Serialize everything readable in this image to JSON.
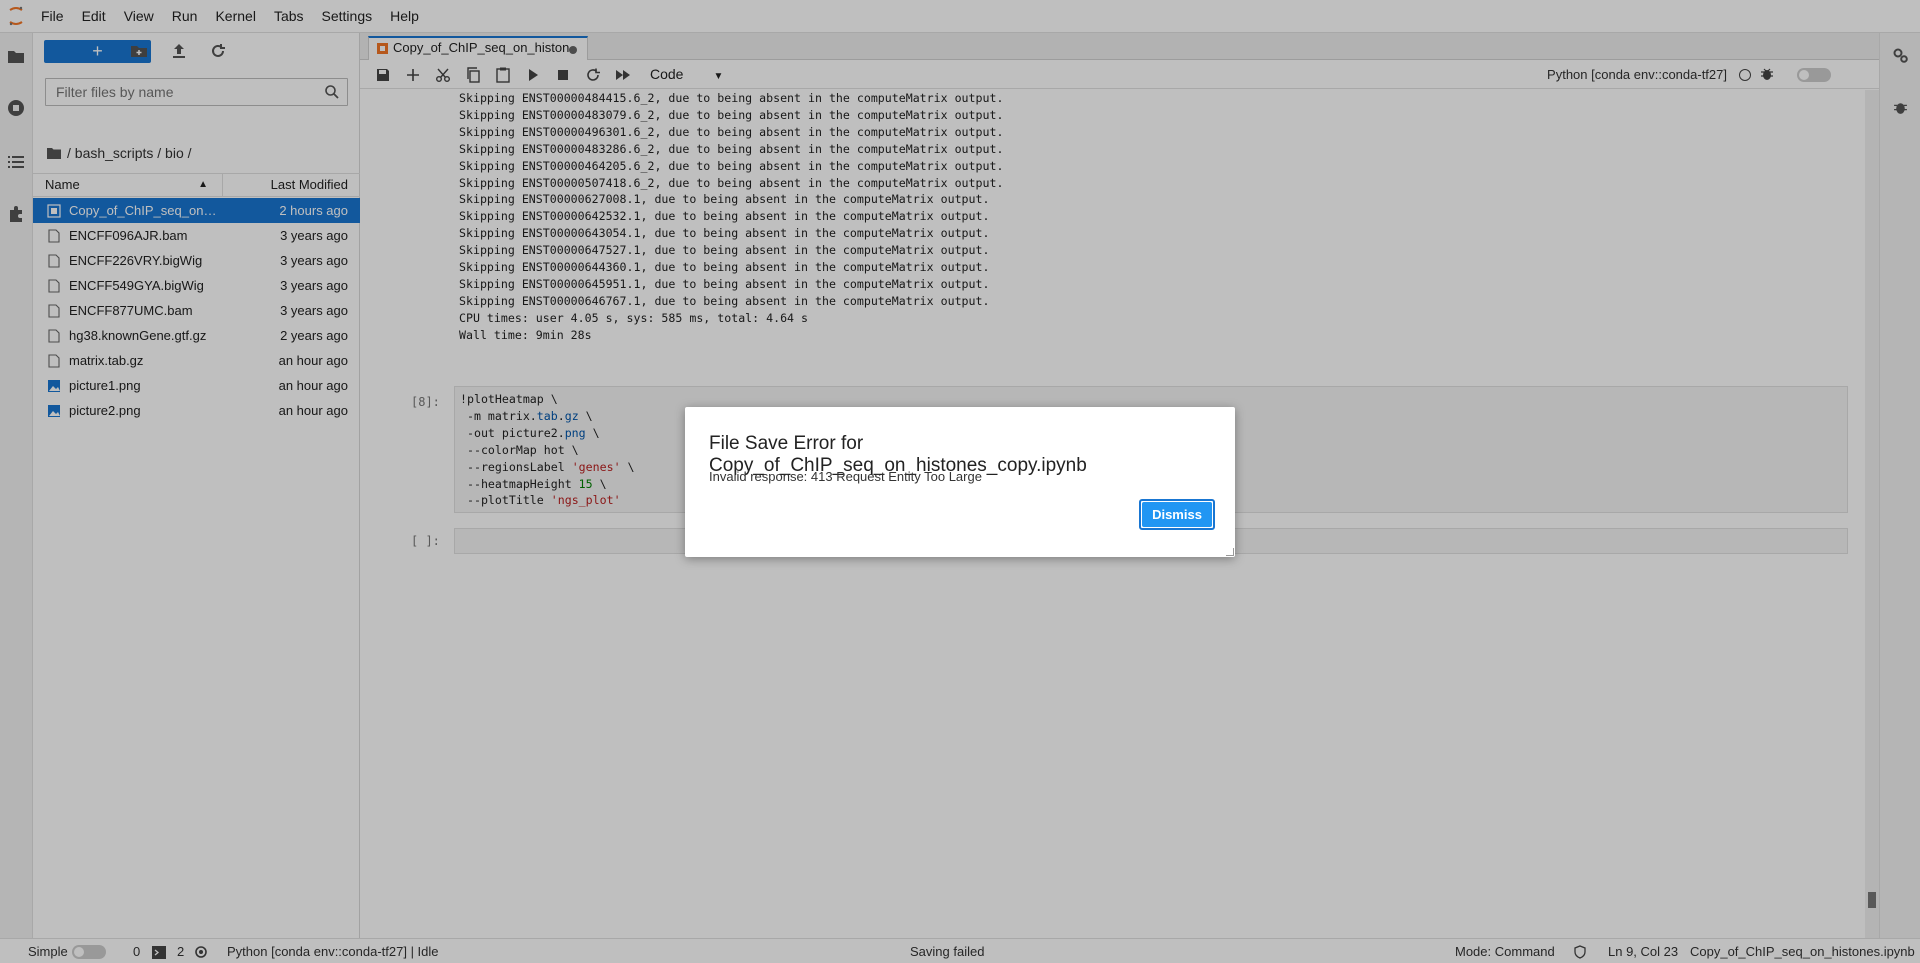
{
  "menubar": {
    "items": [
      "File",
      "Edit",
      "View",
      "Run",
      "Kernel",
      "Tabs",
      "Settings",
      "Help"
    ]
  },
  "filebrowser": {
    "new_label": "+",
    "filter_placeholder": "Filter files by name",
    "breadcrumb": "/ bash_scripts / bio /",
    "col_name": "Name",
    "col_modified": "Last Modified",
    "files": [
      {
        "name": "Copy_of_ChIP_seq_on_hi...",
        "modified": "2 hours ago",
        "icon": "notebook-icon",
        "selected": true
      },
      {
        "name": "ENCFF096AJR.bam",
        "modified": "3 years ago",
        "icon": "file-icon"
      },
      {
        "name": "ENCFF226VRY.bigWig",
        "modified": "3 years ago",
        "icon": "file-icon"
      },
      {
        "name": "ENCFF549GYA.bigWig",
        "modified": "3 years ago",
        "icon": "file-icon"
      },
      {
        "name": "ENCFF877UMC.bam",
        "modified": "3 years ago",
        "icon": "file-icon"
      },
      {
        "name": "hg38.knownGene.gtf.gz",
        "modified": "2 years ago",
        "icon": "file-icon"
      },
      {
        "name": "matrix.tab.gz",
        "modified": "an hour ago",
        "icon": "file-icon"
      },
      {
        "name": "picture1.png",
        "modified": "an hour ago",
        "icon": "image-icon"
      },
      {
        "name": "picture2.png",
        "modified": "an hour ago",
        "icon": "image-icon"
      }
    ]
  },
  "tab": {
    "title": "Copy_of_ChIP_seq_on_histon"
  },
  "toolbar": {
    "cell_type": "Code",
    "kernel": "Python [conda env::conda-tf27]"
  },
  "output_lines": [
    "Skipping ENST00000484415.6_2, due to being absent in the computeMatrix output.",
    "Skipping ENST00000483079.6_2, due to being absent in the computeMatrix output.",
    "Skipping ENST00000496301.6_2, due to being absent in the computeMatrix output.",
    "Skipping ENST00000483286.6_2, due to being absent in the computeMatrix output.",
    "Skipping ENST00000464205.6_2, due to being absent in the computeMatrix output.",
    "Skipping ENST00000507418.6_2, due to being absent in the computeMatrix output.",
    "Skipping ENST00000627008.1, due to being absent in the computeMatrix output.",
    "Skipping ENST00000642532.1, due to being absent in the computeMatrix output.",
    "Skipping ENST00000643054.1, due to being absent in the computeMatrix output.",
    "Skipping ENST00000647527.1, due to being absent in the computeMatrix output.",
    "Skipping ENST00000644360.1, due to being absent in the computeMatrix output.",
    "Skipping ENST00000645951.1, due to being absent in the computeMatrix output.",
    "Skipping ENST00000646767.1, due to being absent in the computeMatrix output.",
    "CPU times: user 4.05 s, sys: 585 ms, total: 4.64 s",
    "Wall time: 9min 28s"
  ],
  "cell8": {
    "prompt": "[8]:",
    "lines": [
      "!plotHeatmap \\",
      " -m matrix.tab.gz \\",
      " -out picture2.png \\",
      " --colorMap hot \\",
      " --regionsLabel 'genes' \\",
      " --heatmapHeight 15 \\",
      " --plotTitle 'ngs_plot'"
    ]
  },
  "empty_cell": {
    "prompt": "[ ]:"
  },
  "statusbar": {
    "simple": "Simple",
    "count1": "0",
    "count2": "2",
    "kernel_status": "Python [conda env::conda-tf27] | Idle",
    "saving": "Saving failed",
    "mode": "Mode: Command",
    "position": "Ln 9, Col 23",
    "filename": "Copy_of_ChIP_seq_on_histones.ipynb"
  },
  "dialog": {
    "title": "File Save Error for Copy_of_ChIP_seq_on_histones_copy.ipynb",
    "message": "Invalid response: 413 Request Entity Too Large",
    "button": "Dismiss"
  },
  "colors": {
    "accent": "#1976d2",
    "dismiss": "#2196f3"
  }
}
